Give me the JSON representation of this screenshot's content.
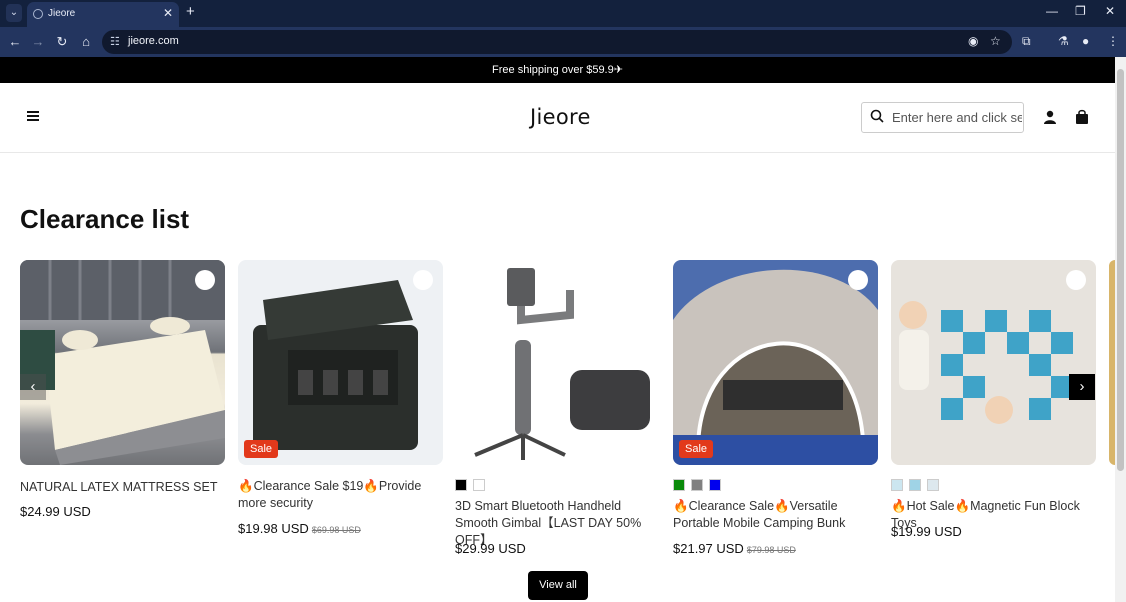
{
  "browser": {
    "tab_title": "Jieore",
    "url": "jieore.com"
  },
  "announcement": "Free shipping over $59.9✈",
  "header": {
    "logo": "Jieore",
    "search_placeholder": "Enter here and click sea"
  },
  "section_title": "Clearance list",
  "products": [
    {
      "title": "NATURAL LATEX MATTRESS SET",
      "price": "$24.99 USD",
      "compare": "",
      "sale": false,
      "swatches": []
    },
    {
      "title": "🔥Clearance Sale $19🔥Provide more security",
      "price": "$19.98 USD",
      "compare": "$69.98 USD",
      "sale": true,
      "sale_label": "Sale",
      "swatches": []
    },
    {
      "title": "3D Smart Bluetooth Handheld Smooth Gimbal【LAST DAY 50% OFF】",
      "price": "$29.99 USD",
      "compare": "",
      "sale": false,
      "swatches": [
        "#000000",
        "#ffffff"
      ]
    },
    {
      "title": "🔥Clearance Sale🔥Versatile Portable Mobile Camping Bunk",
      "price": "$21.97 USD",
      "compare": "$79.98 USD",
      "sale": true,
      "sale_label": "Sale",
      "swatches": [
        "#0a8a0a",
        "#808080",
        "#0000ee"
      ]
    },
    {
      "title": "🔥Hot Sale🔥Magnetic Fun Block Toys",
      "price": "$19.99 USD",
      "compare": "",
      "sale": false,
      "swatches": [
        "#cce6f0",
        "#9fd3e6",
        "#dde8ee"
      ]
    }
  ],
  "view_all": "View all",
  "colors": {
    "sale_badge": "#e2391b",
    "announcement_bg": "#000000"
  }
}
